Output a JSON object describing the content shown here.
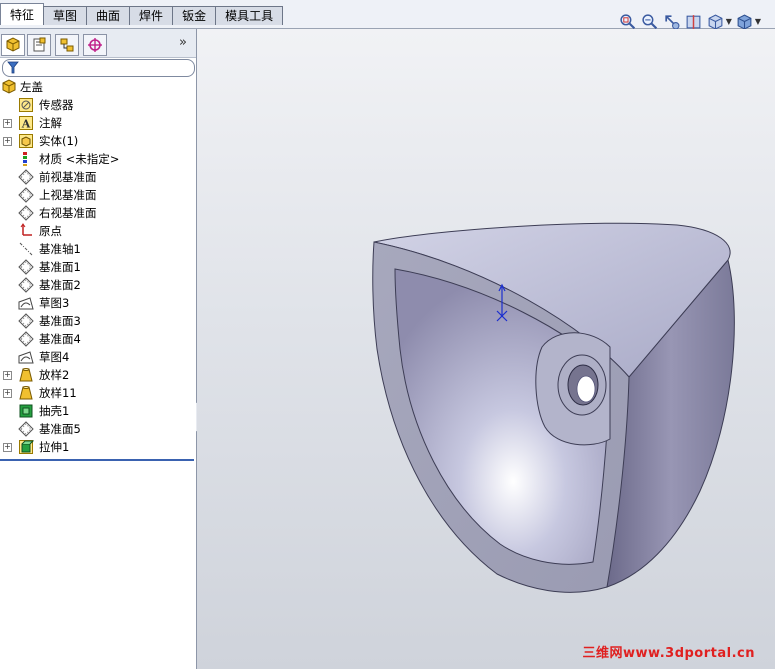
{
  "command_tabs": [
    {
      "label": "特征",
      "active": true
    },
    {
      "label": "草图",
      "active": false
    },
    {
      "label": "曲面",
      "active": false
    },
    {
      "label": "焊件",
      "active": false
    },
    {
      "label": "钣金",
      "active": false
    },
    {
      "label": "模具工具",
      "active": false
    }
  ],
  "view_tools": [
    "zoom-to-fit-icon",
    "zoom-area-icon",
    "previous-view-icon",
    "section-view-icon",
    "view-orientation-icon",
    "display-style-icon"
  ],
  "panel_tabs": [
    "feature-manager-icon",
    "property-manager-icon",
    "configuration-manager-icon",
    "dimxpert-icon"
  ],
  "expand_glyph": "»",
  "tree": {
    "root": "左盖",
    "items": [
      {
        "label": "传感器",
        "icon": "sensor",
        "expandable": false
      },
      {
        "label": "注解",
        "icon": "annotation",
        "expandable": true
      },
      {
        "label": "实体(1)",
        "icon": "solid-bodies",
        "expandable": true
      },
      {
        "label": "材质 <未指定>",
        "icon": "material",
        "expandable": false
      },
      {
        "label": "前视基准面",
        "icon": "plane",
        "expandable": false
      },
      {
        "label": "上视基准面",
        "icon": "plane",
        "expandable": false
      },
      {
        "label": "右视基准面",
        "icon": "plane",
        "expandable": false
      },
      {
        "label": "原点",
        "icon": "origin",
        "expandable": false
      },
      {
        "label": "基准轴1",
        "icon": "axis",
        "expandable": false
      },
      {
        "label": "基准面1",
        "icon": "plane",
        "expandable": false
      },
      {
        "label": "基准面2",
        "icon": "plane",
        "expandable": false
      },
      {
        "label": "草图3",
        "icon": "sketch",
        "expandable": false
      },
      {
        "label": "基准面3",
        "icon": "plane",
        "expandable": false
      },
      {
        "label": "基准面4",
        "icon": "plane",
        "expandable": false
      },
      {
        "label": "草图4",
        "icon": "sketch",
        "expandable": false
      },
      {
        "label": "放样2",
        "icon": "loft",
        "expandable": true
      },
      {
        "label": "放样11",
        "icon": "loft",
        "expandable": true
      },
      {
        "label": "抽壳1",
        "icon": "shell",
        "expandable": false
      },
      {
        "label": "基准面5",
        "icon": "plane",
        "expandable": false
      },
      {
        "label": "拉伸1",
        "icon": "extrude",
        "expandable": true
      }
    ]
  },
  "watermark": "三维网www.3dportal.cn",
  "colors": {
    "accent": "#3a62b0",
    "watermark": "#e02020",
    "model_face": "#b7b8d2"
  }
}
